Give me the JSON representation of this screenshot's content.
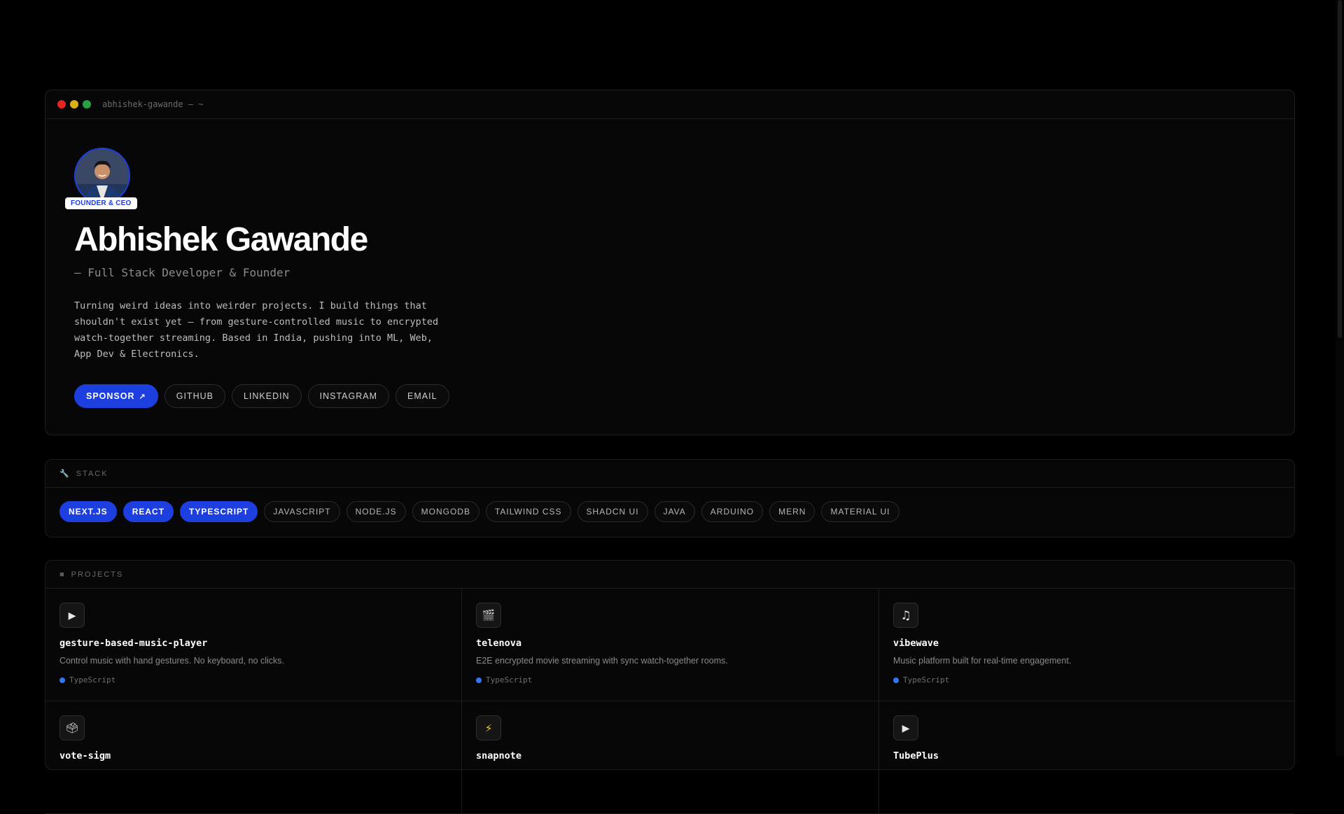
{
  "window": {
    "title": "abhishek-gawande — ~"
  },
  "profile": {
    "badge": "FOUNDER & CEO",
    "name": "Abhishek Gawande",
    "subtitle": "— Full Stack Developer & Founder",
    "bio": "Turning weird ideas into weirder projects. I build things that shouldn't exist yet — from gesture-controlled music to encrypted watch-together streaming. Based in India, pushing into ML, Web, App Dev & Electronics."
  },
  "links": [
    {
      "label": "SPONSOR",
      "icon": "arrow-up-right-icon",
      "primary": true
    },
    {
      "label": "GITHUB"
    },
    {
      "label": "LINKEDIN"
    },
    {
      "label": "INSTAGRAM"
    },
    {
      "label": "EMAIL"
    }
  ],
  "stack": {
    "heading": "STACK",
    "icon": "wrench-icon",
    "items": [
      {
        "label": "NEXT.JS",
        "active": true
      },
      {
        "label": "REACT",
        "active": true
      },
      {
        "label": "TYPESCRIPT",
        "active": true
      },
      {
        "label": "JAVASCRIPT"
      },
      {
        "label": "NODE.JS"
      },
      {
        "label": "MONGODB"
      },
      {
        "label": "TAILWIND CSS"
      },
      {
        "label": "SHADCN UI"
      },
      {
        "label": "JAVA"
      },
      {
        "label": "ARDUINO"
      },
      {
        "label": "MERN"
      },
      {
        "label": "MATERIAL UI"
      }
    ]
  },
  "projects": {
    "heading": "PROJECTS",
    "icon": "square-icon",
    "items": [
      {
        "icon": "play-icon",
        "glyph": "▶",
        "title": "gesture-based-music-player",
        "desc": "Control music with hand gestures. No keyboard, no clicks.",
        "lang": "TypeScript"
      },
      {
        "icon": "clapperboard-icon",
        "glyph": "🎬",
        "title": "telenova",
        "desc": "E2E encrypted movie streaming with sync watch-together rooms.",
        "lang": "TypeScript"
      },
      {
        "icon": "music-note-icon",
        "glyph": "♫",
        "title": "vibewave",
        "desc": "Music platform built for real-time engagement.",
        "lang": "TypeScript"
      },
      {
        "icon": "ballot-box-icon",
        "glyph": "🗳",
        "title": "vote-sigm",
        "desc": "",
        "lang": ""
      },
      {
        "icon": "lightning-icon",
        "glyph": "⚡",
        "title": "snapnote",
        "desc": "",
        "lang": ""
      },
      {
        "icon": "play-icon",
        "glyph": "▶",
        "title": "TubePlus",
        "desc": "",
        "lang": ""
      }
    ]
  },
  "colors": {
    "accent": "#1d3fe0",
    "typescript": "#3178f6",
    "background": "#000000"
  }
}
